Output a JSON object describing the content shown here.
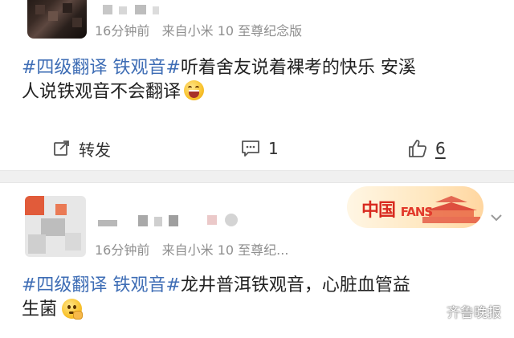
{
  "posts": [
    {
      "meta": {
        "time": "16分钟前",
        "source": "来自小米 10 至尊纪念版"
      },
      "content": {
        "tag1": "#四级翻译",
        "tag2": "铁观音#",
        "text_line1": "听着舍友说着裸考的快乐  安溪",
        "text_line2": "人说铁观音不会翻译",
        "emoji": "laughing-emoji"
      },
      "actions": {
        "repost": "转发",
        "comments": "1",
        "likes": "6"
      }
    },
    {
      "meta": {
        "time": "16分钟前",
        "source": "来自小米 10 至尊纪..."
      },
      "badge": {
        "text": "中国",
        "fans": "FANS"
      },
      "content": {
        "tag1": "#四级翻译",
        "tag2": "铁观音#",
        "text_line1": "龙井普洱铁观音，心脏血管益",
        "text_line2": "生菌",
        "emoji": "thinking-emoji"
      }
    }
  ],
  "watermark": {
    "text": "齐鲁晚报"
  },
  "colors": {
    "tag": "#3e6db5",
    "meta": "#8f8f8f",
    "badge_red": "#d82a20"
  }
}
